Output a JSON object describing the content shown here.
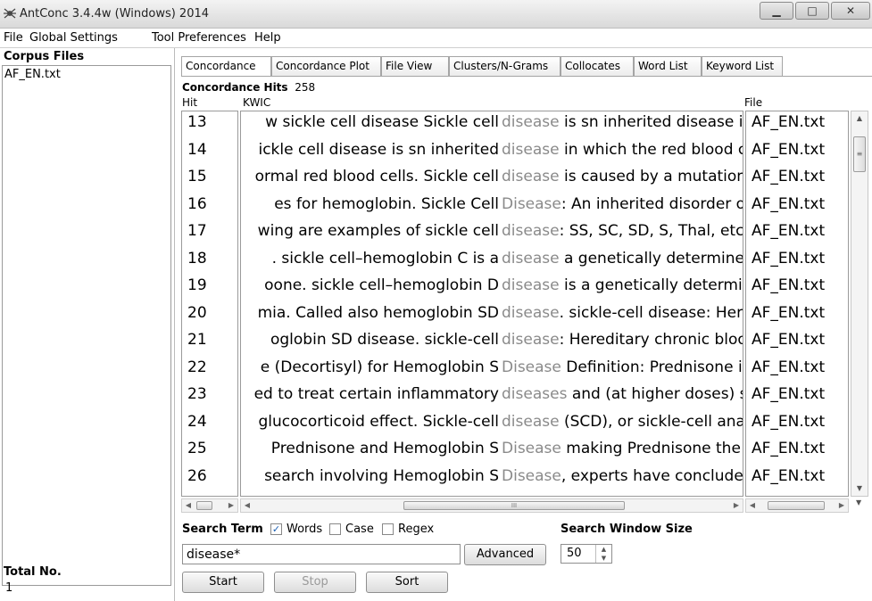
{
  "window": {
    "title": "AntConc 3.4.4w (Windows) 2014"
  },
  "menu": [
    "File",
    "Global Settings",
    "Tool Preferences",
    "Help"
  ],
  "corpus": {
    "header": "Corpus Files",
    "files": [
      "AF_EN.txt"
    ],
    "total_label": "Total No.",
    "total_value": "1"
  },
  "tabs": [
    "Concordance",
    "Concordance Plot",
    "File View",
    "Clusters/N-Grams",
    "Collocates",
    "Word List",
    "Keyword List"
  ],
  "concordance": {
    "hits_label": "Concordance Hits",
    "hits_count": "258",
    "col_hit": "Hit",
    "col_kwic": "KWIC",
    "col_file": "File",
    "rows": [
      {
        "hit": "13",
        "left": "w   sickle cell disease Sickle cell",
        "kw": "disease",
        "right": " is sn inherited disease in",
        "file": "AF_EN.txt"
      },
      {
        "hit": "14",
        "left": "ickle cell disease is sn inherited",
        "kw": "disease",
        "right": " in which the red blood c",
        "file": "AF_EN.txt"
      },
      {
        "hit": "15",
        "left": "ormal red blood cells. Sickle cell",
        "kw": "disease",
        "right": " is caused by a mutation",
        "file": "AF_EN.txt"
      },
      {
        "hit": "16",
        "left": "es for hemoglobin.   Sickle Cell",
        "kw": "Disease",
        "right": ": An inherited disorder o",
        "file": "AF_EN.txt"
      },
      {
        "hit": "17",
        "left": "wing are examples of sickle cell",
        "kw": "disease",
        "right": ": SS, SC, SD, S, Thal, etc.",
        "file": "AF_EN.txt"
      },
      {
        "hit": "18",
        "left": ".   sickle cell–hemoglobin C is a",
        "kw": "disease",
        "right": " a genetically determinec",
        "file": "AF_EN.txt"
      },
      {
        "hit": "19",
        "left": "oone.   sickle cell–hemoglobin D",
        "kw": "disease",
        "right": " is a genetically determin",
        "file": "AF_EN.txt"
      },
      {
        "hit": "20",
        "left": "mia. Called also hemoglobin SD",
        "kw": "disease",
        "right": ".   sickle-cell disease: Her",
        "file": "AF_EN.txt"
      },
      {
        "hit": "21",
        "left": "oglobin SD disease.   sickle-cell",
        "kw": "disease",
        "right": ": Hereditary chronic bloo",
        "file": "AF_EN.txt"
      },
      {
        "hit": "22",
        "left": "e (Decortisyl) for Hemoglobin S",
        "kw": "Disease",
        "right": "  Definition: Prednisone i",
        "file": "AF_EN.txt"
      },
      {
        "hit": "23",
        "left": "ed to treat certain inflammatory",
        "kw": "diseases",
        "right": " and (at higher doses) s",
        "file": "AF_EN.txt"
      },
      {
        "hit": "24",
        "left": "glucocorticoid effect. Sickle-cell",
        "kw": "disease",
        "right": " (SCD), or sickle-cell ana",
        "file": "AF_EN.txt"
      },
      {
        "hit": "25",
        "left": "Prednisone and Hemoglobin S",
        "kw": "Disease",
        "right": " making Prednisone the",
        "file": "AF_EN.txt"
      },
      {
        "hit": "26",
        "left": "search involving Hemoglobin S",
        "kw": "Disease",
        "right": ", experts have concluded",
        "file": "AF_EN.txt"
      }
    ]
  },
  "search": {
    "label": "Search Term",
    "words_label": "Words",
    "words_checked": true,
    "case_label": "Case",
    "case_checked": false,
    "regex_label": "Regex",
    "regex_checked": false,
    "term_value": "disease*",
    "advanced_label": "Advanced",
    "window_size_label": "Search Window Size",
    "window_size_value": "50",
    "start_label": "Start",
    "stop_label": "Stop",
    "sort_label": "Sort"
  },
  "scrollbar_thumb_glyph": "≡",
  "hscroll_thumb_glyph": "III",
  "keyword_color": "#8a8a8a"
}
